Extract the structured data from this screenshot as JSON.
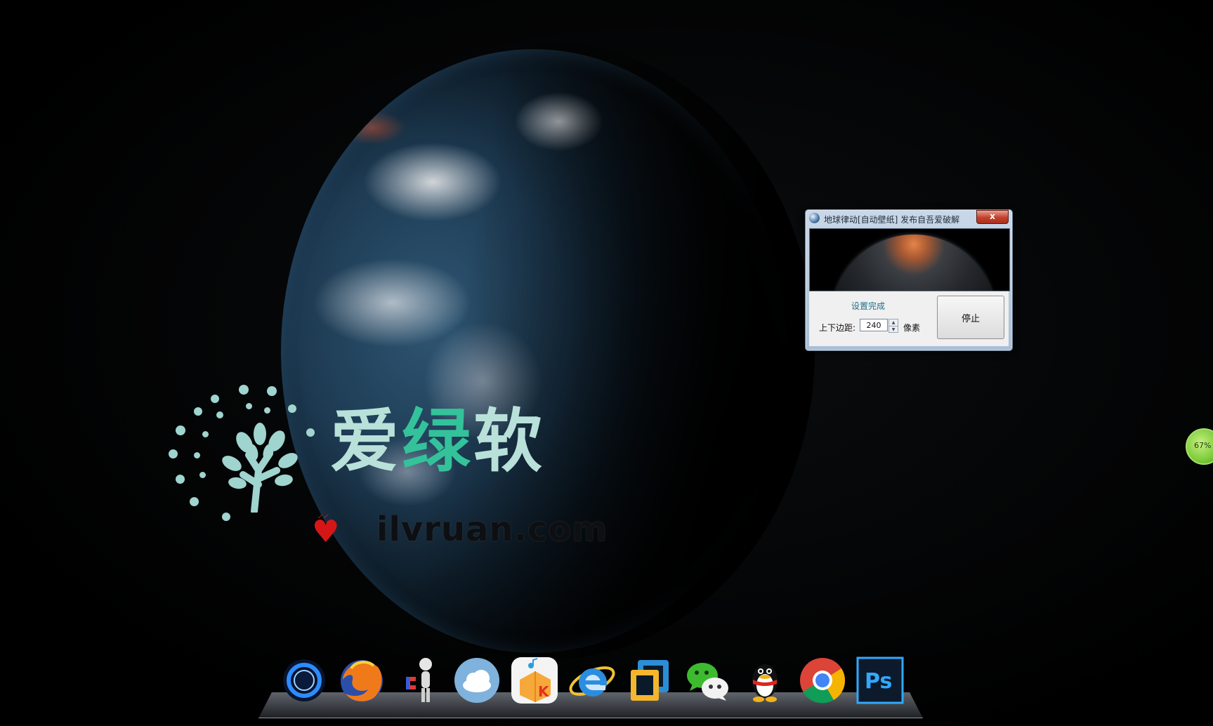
{
  "watermark": {
    "cn_char1": "爱",
    "cn_char2": "绿",
    "cn_char3": "软",
    "url": "ilvruan.com"
  },
  "dialog": {
    "title": "地球律动[自动壁纸]   发布自吾爱破解",
    "close_label": "x",
    "status": "设置完成",
    "margin_label": "上下边距:",
    "margin_value": "240",
    "unit_label": "像素",
    "stop_label": "停止"
  },
  "battery": {
    "percent_text": "67%"
  },
  "dock": {
    "items": [
      "ring-app-icon",
      "firefox-icon",
      "figure-magnet-icon",
      "cloud-icon",
      "kugou-icon",
      "internet-explorer-icon",
      "window-frame-icon",
      "wechat-icon",
      "qq-icon",
      "chrome-icon",
      "photoshop-icon"
    ],
    "photoshop_label": "Ps",
    "kugou_label": "K"
  },
  "colors": {
    "watermark_green": "#34c29b",
    "watermark_light": "#b9e1da",
    "close_red": "#c4412b",
    "status_blue": "#1f6f8b"
  }
}
